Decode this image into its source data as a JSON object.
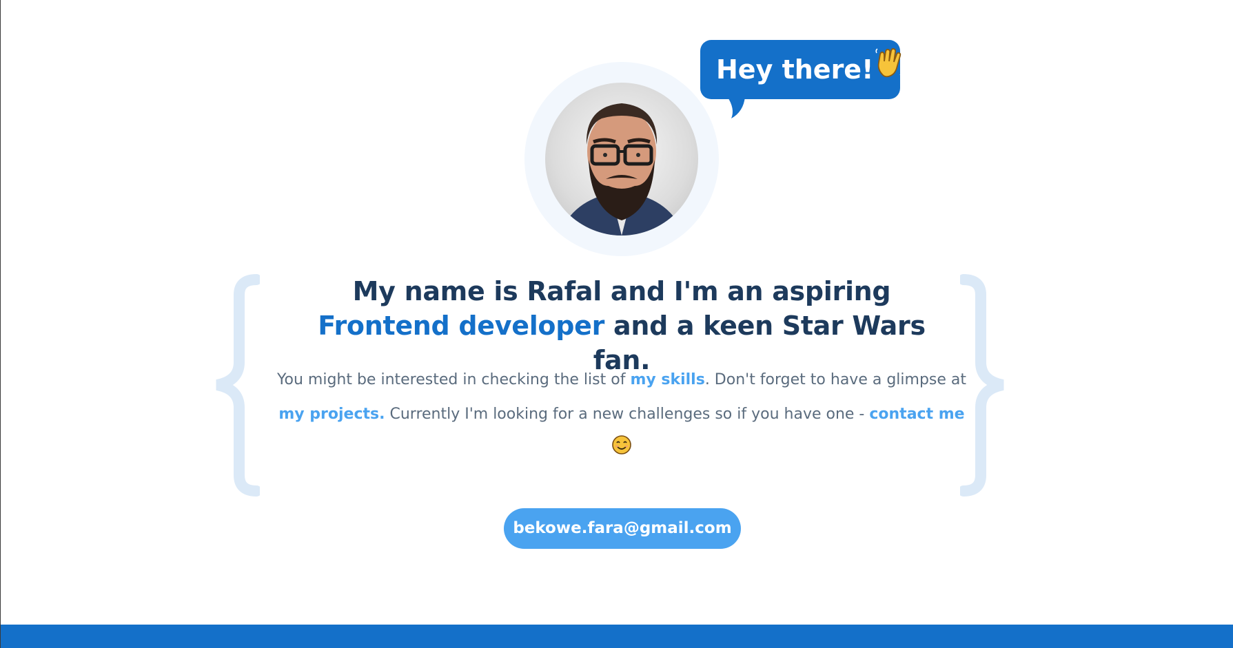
{
  "greeting": {
    "bubble_text": "Hey there!",
    "emoji_icon": "waving-hand-icon"
  },
  "profile": {
    "avatar_icon": "profile-photo"
  },
  "headline": {
    "line1": "My name is Rafal and I'm an aspiring",
    "accent": "Frontend developer",
    "line2_rest": " and a keen Star Wars fan."
  },
  "intro": {
    "part1": "You might be interested in checking the list of ",
    "skills_link": "my skills",
    "part2": ". Don't forget to have a glimpse at ",
    "projects_link": "my projects.",
    "part3": " Currently I'm looking for a new challenges so if you have one - ",
    "contact_link": "contact me",
    "emoji_icon": "smiling-face-icon"
  },
  "contact": {
    "email": "bekowe.fara@gmail.com"
  },
  "colors": {
    "primary": "#1470c9",
    "light_accent": "#4aa3f0",
    "heading": "#1d3a5c",
    "body_text": "#5a6b7d",
    "brace": "#dbe9f7",
    "avatar_ring": "#f2f7fd"
  }
}
